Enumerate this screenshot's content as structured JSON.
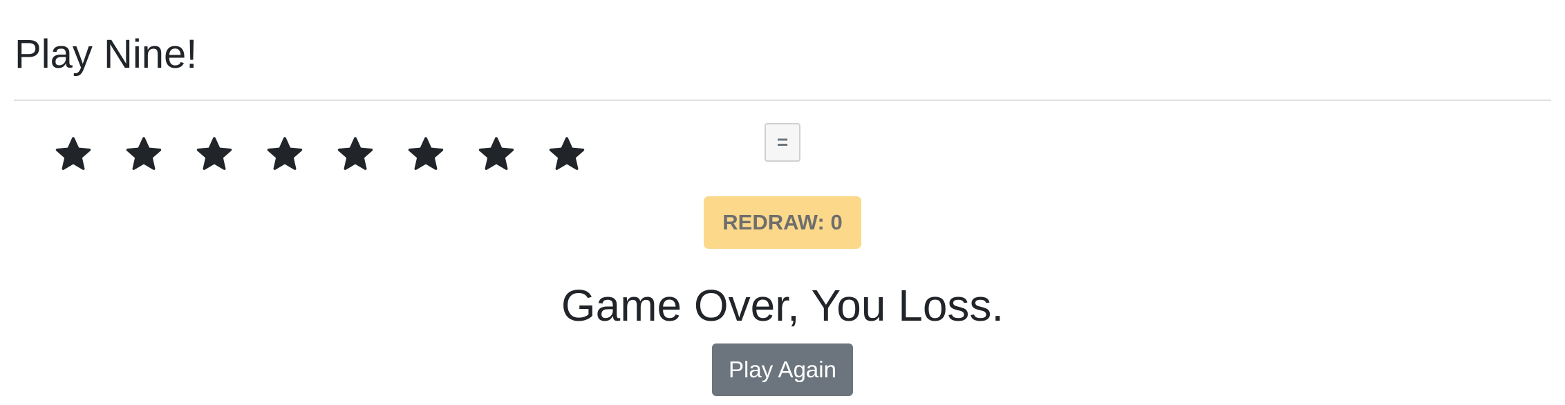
{
  "header": {
    "title": "Play Nine!"
  },
  "stars": {
    "count": 8,
    "icon": "star-icon",
    "color": "#212529"
  },
  "equals_button": {
    "label": "="
  },
  "redraw_button": {
    "label": "REDRAW: 0",
    "color": "#fbd88a"
  },
  "result": {
    "message": "Game Over, You Loss."
  },
  "play_again_button": {
    "label": "Play Again",
    "color": "#6c757d"
  }
}
